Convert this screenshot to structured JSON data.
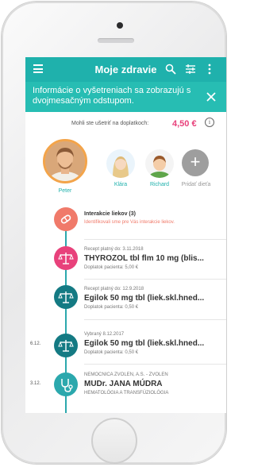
{
  "colors": {
    "accent": "#1fb1ac",
    "banner": "#27bdb3",
    "pink": "#e8417b",
    "allergy": "#f07a6a",
    "prescription": "#e8417b",
    "teal_dark": "#147a83",
    "doctor": "#2ba8ad"
  },
  "header": {
    "title": "Moje zdravie",
    "icons": [
      "menu-icon",
      "search-icon",
      "filter-icon",
      "more-icon"
    ]
  },
  "banner": {
    "text": "Informácie o vyšetreniach sa zobrazujú s dvojmesačným odstupom."
  },
  "savings": {
    "label": "Mohli ste ušetriť na doplatkoch:",
    "value": "4,50 €"
  },
  "profiles": [
    {
      "name": "Peter"
    },
    {
      "name": "Klára"
    },
    {
      "name": "Richard"
    },
    {
      "name": "Pridať dieťa"
    }
  ],
  "timeline": [
    {
      "icon": "pill-icon",
      "small": "",
      "title": "Interakcie liekov (3)",
      "sub": "Identifikovali sme pre Vás interakcie liekov.",
      "date": ""
    },
    {
      "icon": "scales-icon",
      "small": "Recept platný do: 3.11.2018",
      "title": "THYROZOL tbl flm 10 mg (blis...",
      "sub": "Doplatok pacienta: 5,00 €",
      "date": ""
    },
    {
      "icon": "scales-icon",
      "small": "Recept platný do: 12.9.2018",
      "title": "Egilok 50 mg tbl (liek.skl.hned...",
      "sub": "Doplatok pacienta: 0,50 €",
      "date": ""
    },
    {
      "icon": "scales-icon",
      "small": "Vybraný 8.12.2017",
      "title": "Egilok 50 mg tbl (liek.skl.hned...",
      "sub": "Doplatok pacienta: 0,50 €",
      "date": "6.12."
    },
    {
      "icon": "stethoscope-icon",
      "small": "NEMOCNICA ZVOLEN, A.S. - ZVOLEN",
      "title": "MUDr. JANA MÚDRA",
      "sub": "HEMATOLÓGIA A TRANSFÚZIOLÓGIA",
      "date": "3.12."
    }
  ]
}
